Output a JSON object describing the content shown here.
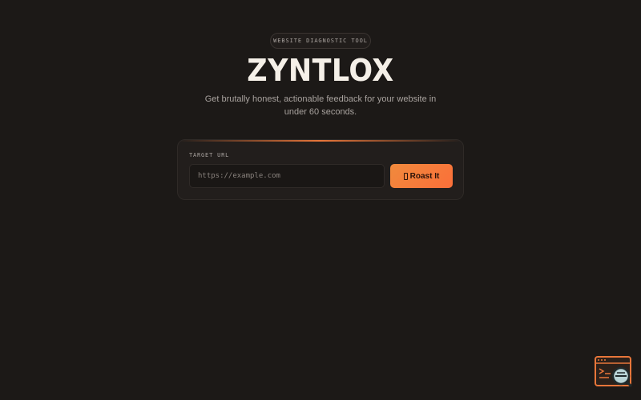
{
  "header": {
    "badge": "WEBSITE DIAGNOSTIC TOOL",
    "title": "ZYNTLOX",
    "subtitle": "Get brutally honest, actionable feedback for your website in under 60 seconds."
  },
  "form": {
    "label": "TARGET URL",
    "input_placeholder": "https://example.com",
    "input_value": "",
    "button_label": "Roast It",
    "button_icon": "flame-icon"
  },
  "widget": {
    "icon": "terminal-search-icon"
  },
  "colors": {
    "background": "#1c1917",
    "accent": "#f08a3c",
    "card": "#221e1c"
  }
}
